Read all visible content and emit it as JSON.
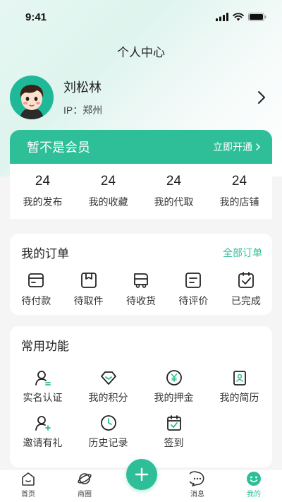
{
  "status_bar": {
    "time": "9:41"
  },
  "page": {
    "title": "个人中心"
  },
  "profile": {
    "name": "刘松林",
    "ip": "IP：郑州"
  },
  "member": {
    "title": "暂不是会员",
    "action": "立即开通"
  },
  "stats": [
    {
      "value": "24",
      "label": "我的发布"
    },
    {
      "value": "24",
      "label": "我的收藏"
    },
    {
      "value": "24",
      "label": "我的代取"
    },
    {
      "value": "24",
      "label": "我的店铺"
    }
  ],
  "orders": {
    "title": "我的订单",
    "link": "全部订单",
    "items": [
      {
        "label": "待付款",
        "icon": "wallet-icon"
      },
      {
        "label": "待取件",
        "icon": "package-icon"
      },
      {
        "label": "待收货",
        "icon": "truck-icon"
      },
      {
        "label": "待评价",
        "icon": "review-icon"
      },
      {
        "label": "已完成",
        "icon": "completed-icon"
      }
    ]
  },
  "functions": {
    "title": "常用功能",
    "items": [
      {
        "label": "实名认证",
        "icon": "user-verify-icon"
      },
      {
        "label": "我的积分",
        "icon": "diamond-icon"
      },
      {
        "label": "我的押金",
        "icon": "yen-coin-icon"
      },
      {
        "label": "我的简历",
        "icon": "resume-icon"
      },
      {
        "label": "邀请有礼",
        "icon": "invite-user-icon"
      },
      {
        "label": "历史记录",
        "icon": "clock-icon"
      },
      {
        "label": "签到",
        "icon": "calendar-check-icon"
      }
    ]
  },
  "tabbar": [
    {
      "label": "首页",
      "icon": "home-icon"
    },
    {
      "label": "商圈",
      "icon": "planet-icon"
    },
    {
      "label": "消息",
      "icon": "message-icon"
    },
    {
      "label": "我的",
      "icon": "smile-icon",
      "active": true
    }
  ],
  "colors": {
    "accent": "#2ebf98"
  }
}
